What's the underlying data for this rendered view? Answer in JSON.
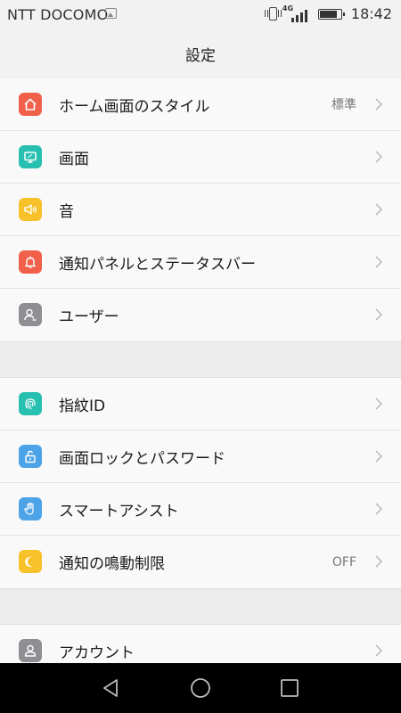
{
  "status_bar": {
    "carrier": "NTT DOCOMO",
    "network": "4G",
    "time": "18:42",
    "battery_level": 0.9
  },
  "header": {
    "title": "設定"
  },
  "groups": [
    {
      "items": [
        {
          "label": "ホーム画面のスタイル",
          "value": "標準",
          "icon": "home-icon",
          "color": "#f0604a"
        },
        {
          "label": "画面",
          "value": "",
          "icon": "display-icon",
          "color": "#26bfb0"
        },
        {
          "label": "音",
          "value": "",
          "icon": "speaker-icon",
          "color": "#f7c12a"
        },
        {
          "label": "通知パネルとステータスバー",
          "value": "",
          "icon": "notification-bell-icon",
          "color": "#f0604a"
        },
        {
          "label": "ユーザー",
          "value": "",
          "icon": "user-icon",
          "color": "#8e8e93"
        }
      ]
    },
    {
      "items": [
        {
          "label": "指紋ID",
          "value": "",
          "icon": "fingerprint-icon",
          "color": "#26bfb0"
        },
        {
          "label": "画面ロックとパスワード",
          "value": "",
          "icon": "unlock-icon",
          "color": "#4ca3e8"
        },
        {
          "label": "スマートアシスト",
          "value": "",
          "icon": "hand-icon",
          "color": "#4ca3e8"
        },
        {
          "label": "通知の鳴動制限",
          "value": "OFF",
          "icon": "moon-icon",
          "color": "#f7c12a"
        }
      ]
    },
    {
      "items": [
        {
          "label": "アカウント",
          "value": "",
          "icon": "account-icon",
          "color": "#8e8e93"
        }
      ]
    }
  ]
}
